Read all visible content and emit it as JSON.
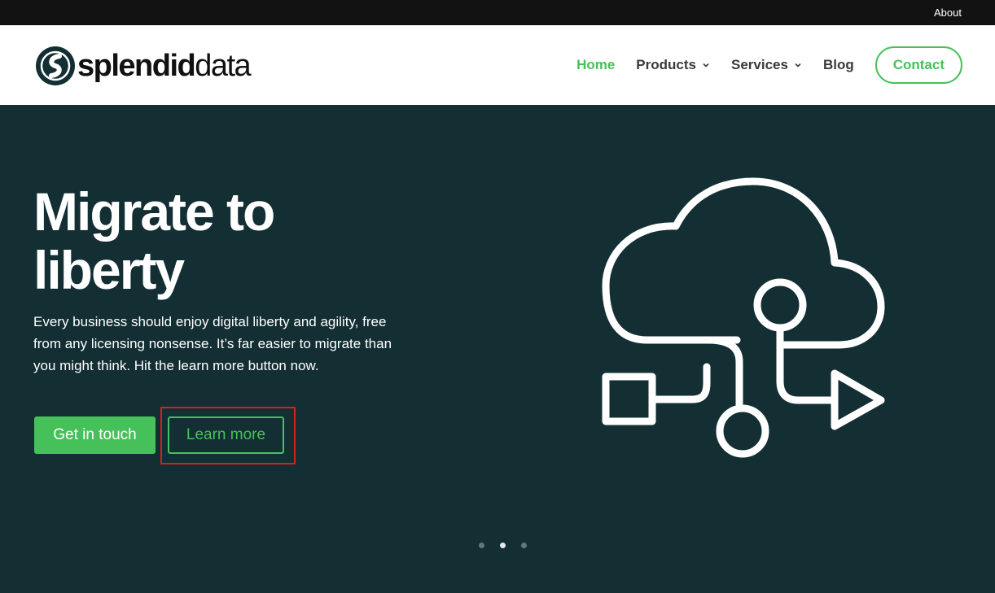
{
  "topbar": {
    "about_label": "About"
  },
  "logo": {
    "bold": "splendid",
    "light": "data"
  },
  "nav": {
    "items": [
      {
        "label": "Home"
      },
      {
        "label": "Products"
      },
      {
        "label": "Services"
      },
      {
        "label": "Blog"
      }
    ],
    "contact_label": "Contact"
  },
  "hero": {
    "title": "Migrate to liberty",
    "text": "Every business should enjoy digital liberty and agility, free from any licensing nonsense. It’s far easier to migrate than you might think. Hit the learn more button now.",
    "primary_button": "Get in touch",
    "secondary_button": "Learn more",
    "graphic_icon": "cloud-flow-icon"
  },
  "slider": {
    "slide_count": 3,
    "active_slide": 2
  },
  "colors": {
    "accent": "#46c15a",
    "hero_bg": "#132f34",
    "topbar_bg": "#121212",
    "highlight": "#d81e1e"
  }
}
